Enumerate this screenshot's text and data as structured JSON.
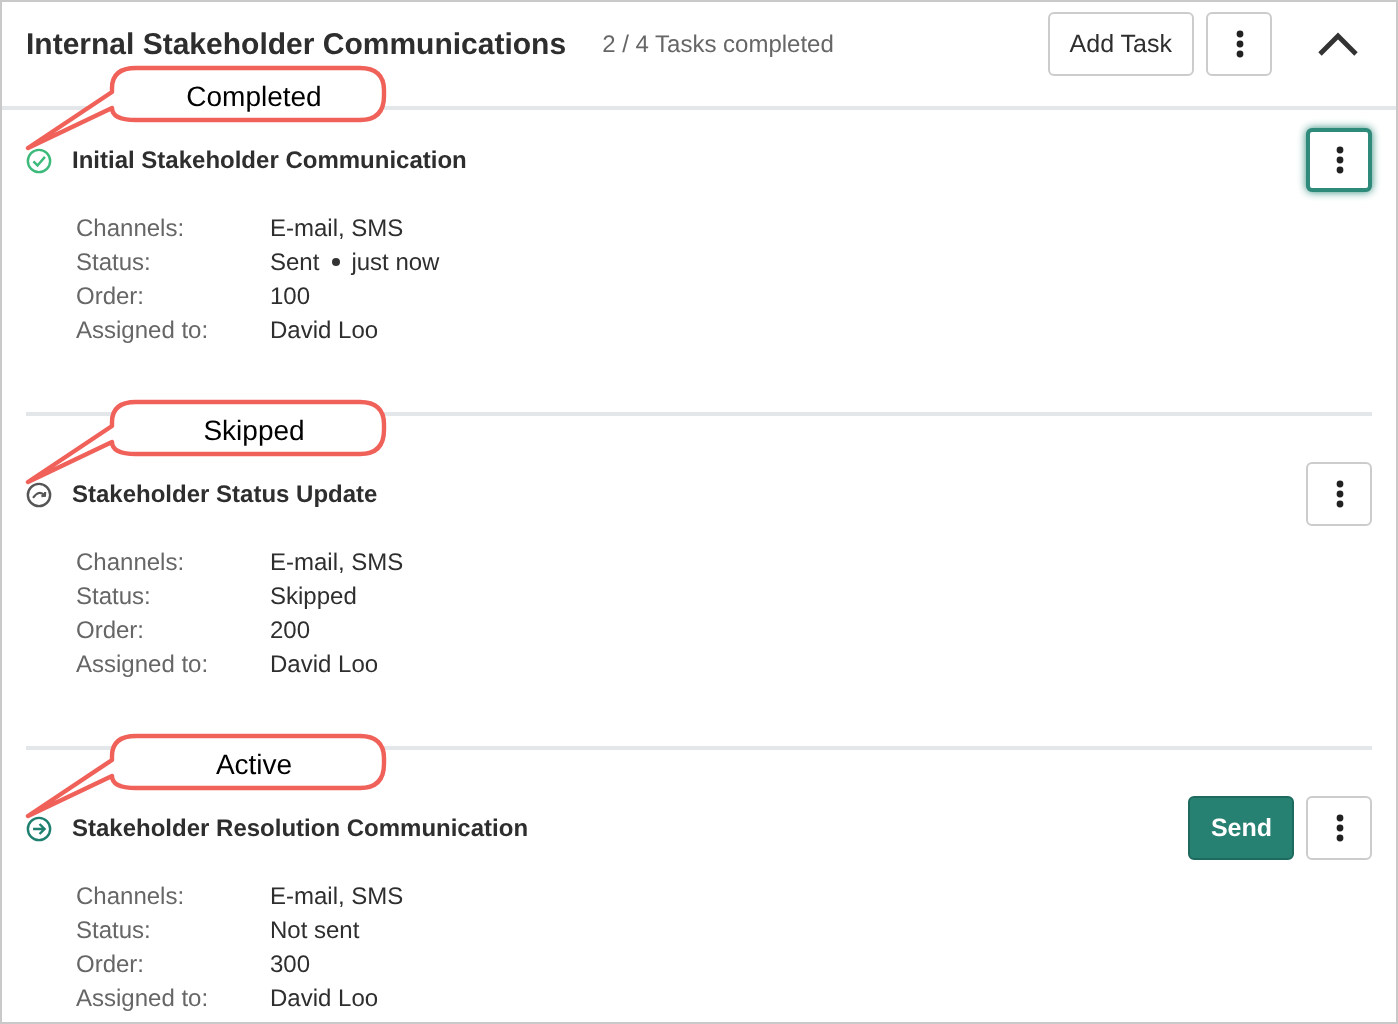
{
  "header": {
    "title": "Internal Stakeholder Communications",
    "progress": "2 / 4 Tasks completed",
    "add_button": "Add Task",
    "expanded": true
  },
  "tasks": [
    {
      "kind": "completed",
      "callout": "Completed",
      "title": "Initial Stakeholder Communication",
      "menu_focused": true,
      "fields": [
        {
          "label": "Channels:",
          "value": "E-mail, SMS"
        },
        {
          "label": "Status:",
          "value": "Sent",
          "time": "just now"
        },
        {
          "label": "Order:",
          "value": "100"
        },
        {
          "label": "Assigned to:",
          "value": "David Loo"
        }
      ]
    },
    {
      "kind": "skipped",
      "callout": "Skipped",
      "title": "Stakeholder Status Update",
      "menu_focused": false,
      "fields": [
        {
          "label": "Channels:",
          "value": "E-mail, SMS"
        },
        {
          "label": "Status:",
          "value": "Skipped"
        },
        {
          "label": "Order:",
          "value": "200"
        },
        {
          "label": "Assigned to:",
          "value": "David Loo"
        }
      ]
    },
    {
      "kind": "active",
      "callout": "Active",
      "title": "Stakeholder Resolution Communication",
      "action": "Send",
      "menu_focused": false,
      "fields": [
        {
          "label": "Channels:",
          "value": "E-mail, SMS"
        },
        {
          "label": "Status:",
          "value": "Not sent"
        },
        {
          "label": "Order:",
          "value": "300"
        },
        {
          "label": "Assigned to:",
          "value": "David Loo"
        }
      ]
    }
  ]
}
